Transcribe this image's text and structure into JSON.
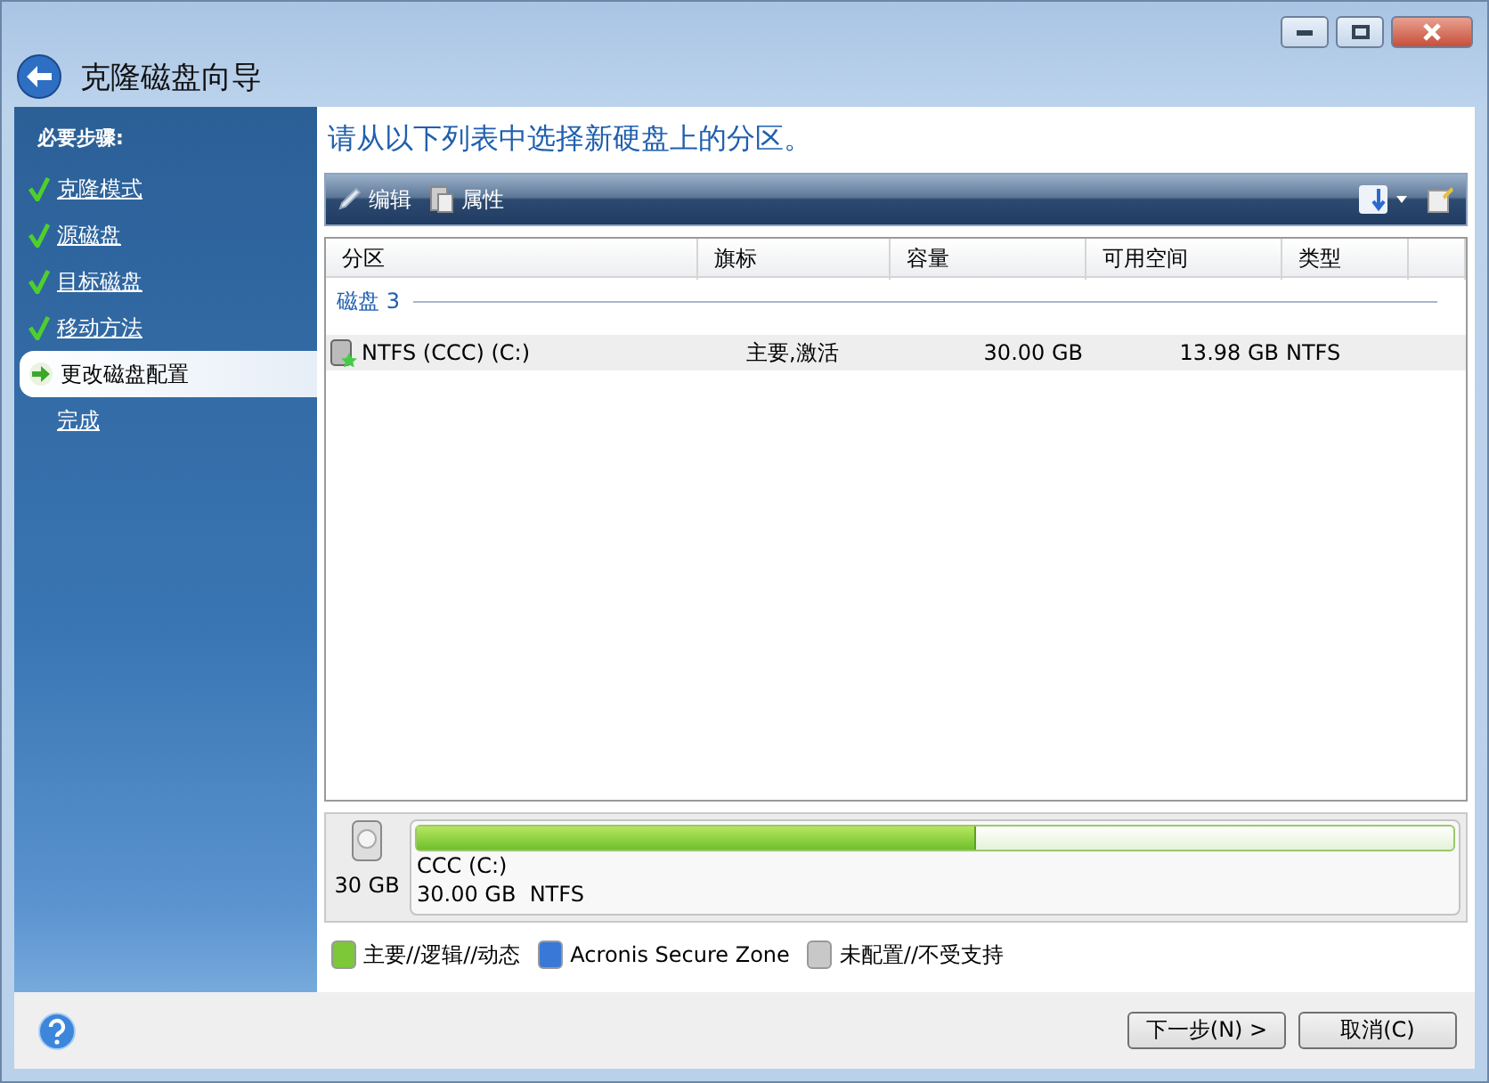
{
  "window": {
    "title": "克隆磁盘向导"
  },
  "sidebar": {
    "heading": "必要步骤:",
    "items": [
      {
        "label": "克隆模式",
        "done": true,
        "selected": false
      },
      {
        "label": "源磁盘",
        "done": true,
        "selected": false
      },
      {
        "label": "目标磁盘",
        "done": true,
        "selected": false
      },
      {
        "label": "移动方法",
        "done": true,
        "selected": false
      },
      {
        "label": "更改磁盘配置",
        "done": false,
        "selected": true
      },
      {
        "label": "完成",
        "done": false,
        "selected": false
      }
    ]
  },
  "heading": "请从以下列表中选择新硬盘上的分区。",
  "toolbar": {
    "items": [
      {
        "label": "编辑",
        "kind": "edit"
      },
      {
        "label": "属性",
        "kind": "properties"
      }
    ]
  },
  "table": {
    "columns": [
      "分区",
      "旗标",
      "容量",
      "可用空间",
      "类型"
    ],
    "groups": [
      {
        "label": "磁盘 3",
        "rows": [
          {
            "partition": "NTFS (CCC) (C:)",
            "flags": "主要,激活",
            "capacity": "30.00 GB",
            "free": "13.98 GB",
            "type": "NTFS",
            "selected": false
          }
        ]
      }
    ]
  },
  "disk_map": {
    "size": "30 GB",
    "partition": {
      "name": "CCC (C:)",
      "details": "30.00 GB  NTFS",
      "level": 0.54
    }
  },
  "legend": [
    {
      "label": "主要//逻辑//动态",
      "color": "#7cc838"
    },
    {
      "label": "Acronis Secure Zone",
      "color": "#3a78d8"
    },
    {
      "label": "未配置//不受支持",
      "color": "#c8c8c8"
    }
  ],
  "buttons": [
    {
      "label": "下一步(N) >"
    },
    {
      "label": "取消(C)"
    }
  ]
}
